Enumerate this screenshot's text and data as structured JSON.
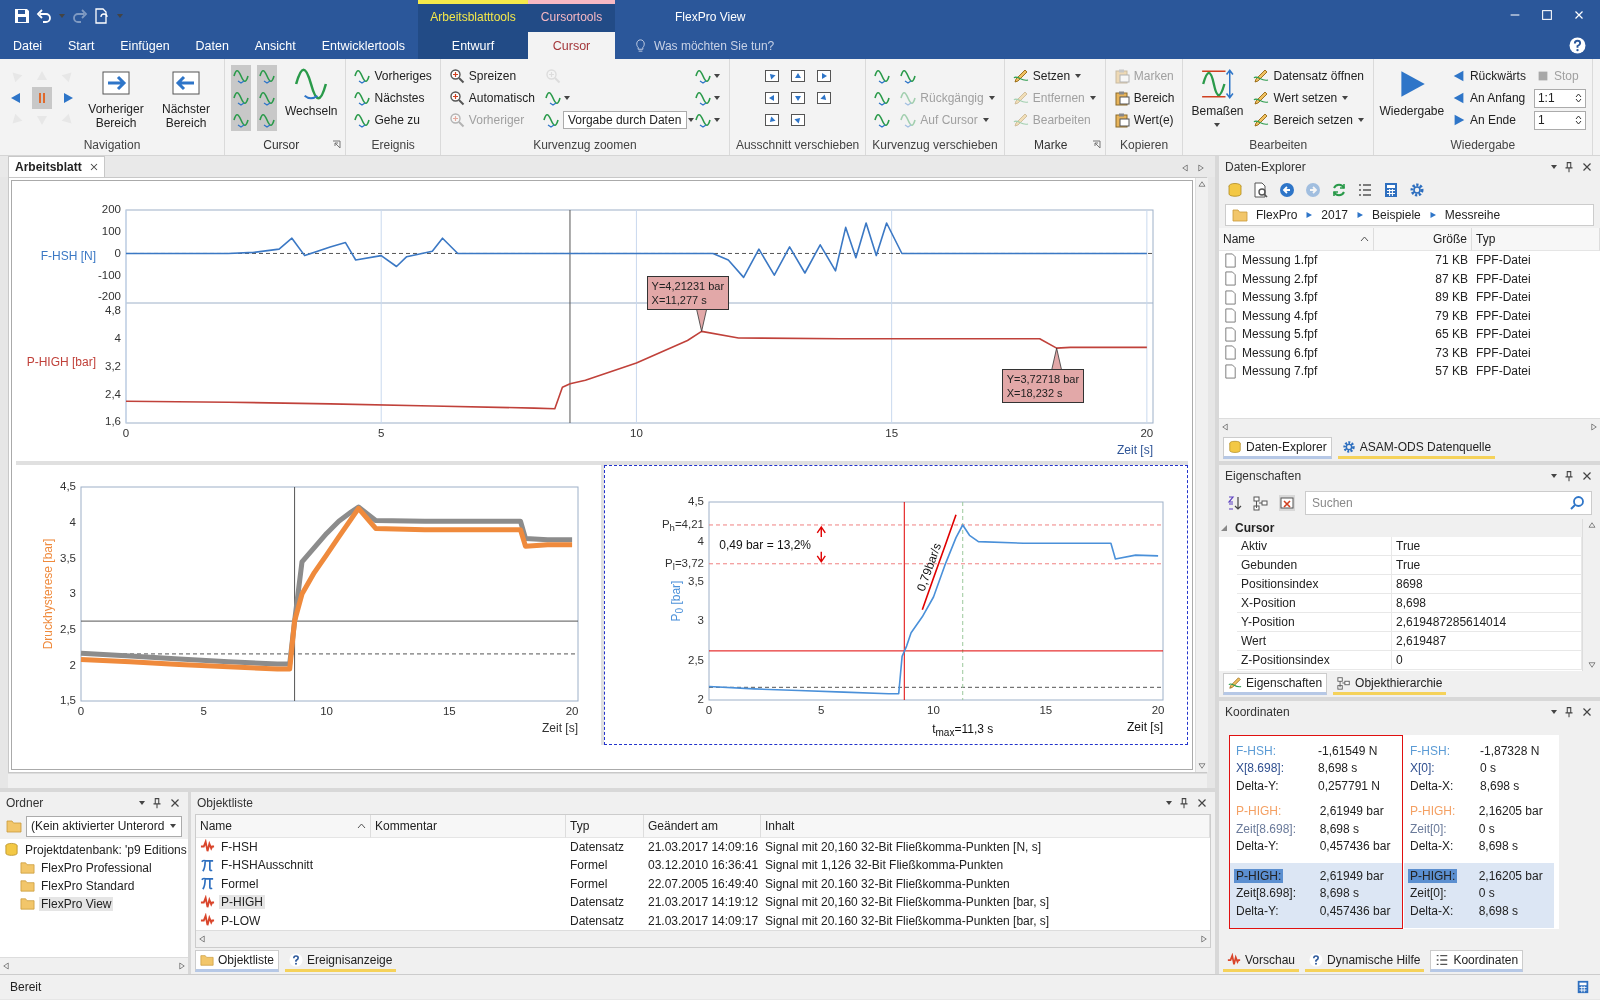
{
  "title_bar": {
    "title": "FlexPro View",
    "context_tabs": [
      {
        "label": "Arbeitsblatttools",
        "color": "#f5e94a"
      },
      {
        "label": "Cursortools",
        "color": "#f7b9c4"
      }
    ]
  },
  "tabs": [
    {
      "label": "Datei",
      "selected": false,
      "contextual": false
    },
    {
      "label": "Start",
      "selected": false,
      "contextual": false
    },
    {
      "label": "Einfügen",
      "selected": false,
      "contextual": false
    },
    {
      "label": "Daten",
      "selected": false,
      "contextual": false
    },
    {
      "label": "Ansicht",
      "selected": false,
      "contextual": false
    },
    {
      "label": "Entwicklertools",
      "selected": false,
      "contextual": false
    },
    {
      "label": "Entwurf",
      "selected": false,
      "contextual": true
    },
    {
      "label": "Cursor",
      "selected": true,
      "contextual": true
    }
  ],
  "search": {
    "placeholder": "Was möchten Sie tun?"
  },
  "ribbon": [
    {
      "label": "Navigation",
      "launcher": false,
      "items": [
        {
          "kind": "icon",
          "disabled": true,
          "menu": false
        },
        {
          "kind": "icon",
          "disabled": false,
          "menu": false
        },
        {
          "kind": "icon",
          "disabled": true,
          "menu": false
        },
        {
          "kind": "icon",
          "disabled": true,
          "menu": false
        },
        {
          "kind": "icon",
          "disabled": false,
          "menu": false
        },
        {
          "kind": "icon",
          "disabled": true,
          "menu": false
        },
        {
          "kind": "icon",
          "disabled": true,
          "menu": false
        },
        {
          "kind": "icon",
          "disabled": false,
          "menu": false
        },
        {
          "kind": "icon",
          "disabled": true,
          "menu": false
        },
        {
          "kind": "large",
          "label": "Vorheriger Bereich",
          "disabled": false,
          "menu": false
        },
        {
          "kind": "large",
          "label": "Nächster Bereich",
          "disabled": false,
          "menu": false
        }
      ]
    },
    {
      "label": "Cursor",
      "launcher": true,
      "items": [
        {
          "kind": "icon",
          "disabled": false,
          "menu": false
        },
        {
          "kind": "icon",
          "disabled": false,
          "menu": false
        },
        {
          "kind": "icon",
          "disabled": false,
          "menu": false
        },
        {
          "kind": "icon",
          "disabled": false,
          "menu": false
        },
        {
          "kind": "icon",
          "disabled": false,
          "menu": false
        },
        {
          "kind": "icon",
          "disabled": false,
          "menu": false
        },
        {
          "kind": "large",
          "label": "Wechseln",
          "disabled": false,
          "menu": false
        }
      ]
    },
    {
      "label": "Ereignis",
      "launcher": false,
      "items": [
        {
          "kind": "small",
          "label": "Vorheriges",
          "disabled": false,
          "menu": false
        },
        {
          "kind": "small",
          "label": "Nächstes",
          "disabled": false,
          "menu": false
        },
        {
          "kind": "small",
          "label": "Gehe zu",
          "disabled": false,
          "menu": false
        }
      ]
    },
    {
      "label": "Kurvenzug zoomen",
      "launcher": false,
      "items": [
        {
          "kind": "small",
          "label": "Spreizen",
          "disabled": false,
          "menu": false
        },
        {
          "kind": "small",
          "label": "Automatisch",
          "disabled": false,
          "menu": false
        },
        {
          "kind": "small",
          "label": "Vorheriger",
          "disabled": true,
          "menu": false
        },
        {
          "kind": "icon",
          "disabled": true,
          "menu": false
        },
        {
          "kind": "icon",
          "disabled": false,
          "menu": true
        },
        {
          "kind": "select",
          "value": "Vorgabe durch Daten",
          "disabled": false,
          "menu": true
        },
        {
          "kind": "icon",
          "disabled": false,
          "menu": true
        },
        {
          "kind": "icon",
          "disabled": false,
          "menu": true
        },
        {
          "kind": "icon",
          "disabled": false,
          "menu": true
        }
      ]
    },
    {
      "label": "Ausschnitt verschieben",
      "launcher": false,
      "items": [
        {
          "kind": "icon",
          "disabled": false,
          "menu": false
        },
        {
          "kind": "icon",
          "disabled": false,
          "menu": false
        },
        {
          "kind": "icon",
          "disabled": false,
          "menu": false
        },
        {
          "kind": "icon",
          "disabled": false,
          "menu": false
        },
        {
          "kind": "icon",
          "disabled": false,
          "menu": false
        },
        {
          "kind": "icon",
          "disabled": false,
          "menu": false
        },
        {
          "kind": "icon",
          "disabled": false,
          "menu": false
        },
        {
          "kind": "icon",
          "disabled": false,
          "menu": false
        }
      ]
    },
    {
      "label": "Kurvenzug verschieben",
      "launcher": false,
      "items": [
        {
          "kind": "icon",
          "disabled": false,
          "menu": false
        },
        {
          "kind": "icon",
          "disabled": false,
          "menu": false
        },
        {
          "kind": "icon",
          "disabled": false,
          "menu": false
        },
        {
          "kind": "icon",
          "disabled": false,
          "menu": false
        },
        {
          "kind": "small",
          "label": "Rückgängig",
          "disabled": true,
          "menu": true
        },
        {
          "kind": "small",
          "label": "Auf Cursor",
          "disabled": true,
          "menu": true
        }
      ]
    },
    {
      "label": "Marke",
      "launcher": true,
      "items": [
        {
          "kind": "small",
          "label": "Setzen",
          "disabled": false,
          "menu": true
        },
        {
          "kind": "small",
          "label": "Entfernen",
          "disabled": true,
          "menu": true
        },
        {
          "kind": "small",
          "label": "Bearbeiten",
          "disabled": true,
          "menu": false
        }
      ]
    },
    {
      "label": "Kopieren",
      "launcher": false,
      "items": [
        {
          "kind": "small",
          "label": "Marken",
          "disabled": true,
          "menu": false
        },
        {
          "kind": "small",
          "label": "Bereich",
          "disabled": false,
          "menu": false
        },
        {
          "kind": "small",
          "label": "Wert(e)",
          "disabled": false,
          "menu": false
        }
      ]
    },
    {
      "label": "Bearbeiten",
      "launcher": false,
      "items": [
        {
          "kind": "large",
          "label": "Bemaßen",
          "disabled": false,
          "menu": true
        },
        {
          "kind": "small",
          "label": "Datensatz öffnen",
          "disabled": false,
          "menu": false
        },
        {
          "kind": "small",
          "label": "Wert setzen",
          "disabled": false,
          "menu": true
        },
        {
          "kind": "small",
          "label": "Bereich setzen",
          "disabled": false,
          "menu": true
        }
      ]
    },
    {
      "label": "Wiedergabe",
      "launcher": false,
      "items": [
        {
          "kind": "large",
          "label": "Wiedergabe",
          "disabled": false,
          "menu": false
        },
        {
          "kind": "small",
          "label": "Rückwärts",
          "disabled": false,
          "menu": false
        },
        {
          "kind": "small",
          "label": "An Anfang",
          "disabled": false,
          "menu": false
        },
        {
          "kind": "small",
          "label": "An Ende",
          "disabled": false,
          "menu": false
        },
        {
          "kind": "small",
          "label": "Stop",
          "disabled": true,
          "menu": false
        },
        {
          "kind": "spin",
          "value": "1:1",
          "disabled": false,
          "menu": false
        },
        {
          "kind": "spin",
          "value": "1",
          "disabled": false,
          "menu": false
        }
      ]
    }
  ],
  "document_tab": {
    "label": "Arbeitsblatt",
    "selected": true
  },
  "worksheet": {
    "charts": [
      {
        "chart_data": {
          "type": "line",
          "grid": true,
          "ylabel": "F-HSH [N]",
          "xlim": [
            0,
            20.12
          ],
          "ylim": [
            -228,
            200
          ],
          "yticks": [
            -200,
            -100,
            0,
            100,
            200
          ],
          "x": [
            0,
            0.5,
            1,
            1.5,
            2,
            2.5,
            3,
            3.25,
            3.5,
            4,
            4.3,
            4.5,
            5,
            5.3,
            5.5,
            6,
            6.2,
            6.5,
            7,
            8,
            9,
            10,
            11,
            11.5,
            11.8,
            12.1,
            12.4,
            12.7,
            13,
            13.3,
            13.6,
            13.9,
            14.1,
            14.3,
            14.5,
            14.7,
            14.9,
            15.2,
            15.5,
            16,
            17,
            18,
            19,
            20
          ],
          "series": [
            {
              "color": "#3b78c4",
              "values": [
                0,
                0,
                0,
                0,
                0,
                5,
                20,
                70,
                -10,
                30,
                50,
                -30,
                -10,
                -60,
                -15,
                10,
                70,
                0,
                0,
                0,
                0,
                0,
                0,
                0,
                -30,
                -110,
                20,
                -100,
                30,
                -90,
                40,
                -80,
                120,
                -20,
                140,
                -10,
                140,
                0,
                0,
                0,
                0,
                0,
                0,
                0
              ]
            }
          ],
          "ref_lines": [
            {
              "axis": "x",
              "value": 8.698,
              "color": "#555555"
            },
            {
              "axis": "y",
              "value": 0,
              "color": "#555555"
            }
          ]
        }
      },
      {
        "chart_data": {
          "type": "line",
          "grid": true,
          "ylabel": "P-HIGH [bar]",
          "xlabel": "Zeit [s]",
          "xlim": [
            0,
            20.12
          ],
          "ylim": [
            1.57,
            5.03
          ],
          "xticks": [
            0,
            5,
            10,
            15,
            20
          ],
          "yticks": [
            {
              "value": 1.6,
              "label": "1,6"
            },
            {
              "value": 2.4,
              "label": "2,4"
            },
            {
              "value": 3.2,
              "label": "3,2"
            },
            {
              "value": 4,
              "label": "4"
            },
            {
              "value": 4.8,
              "label": "4,8"
            }
          ],
          "x": [
            0,
            2,
            4,
            6,
            8,
            8.4,
            8.55,
            8.7,
            9,
            10,
            11,
            11.277,
            12,
            14,
            16,
            17.9,
            18.232,
            18.5,
            20
          ],
          "series": [
            {
              "color": "#c0413a",
              "values": [
                2.2,
                2.17,
                2.12,
                2.06,
                2.0,
                1.98,
                2.6,
                2.7,
                2.8,
                3.3,
                3.95,
                4.21,
                4.02,
                4.0,
                4.0,
                4.0,
                3.73,
                3.75,
                3.75
              ]
            }
          ],
          "ref_lines": [
            {
              "axis": "x",
              "value": 8.698,
              "color": "#555555"
            }
          ],
          "annotations": [
            {
              "x": 11.277,
              "y": 4.21231,
              "text": "Y=4,21231 bar\nX=11,277 s"
            },
            {
              "x": 18.232,
              "y": 3.72718,
              "text": "Y=3,72718 bar\nX=18,232 s"
            }
          ]
        }
      },
      {
        "chart_data": {
          "type": "line",
          "ylabel": "Druckhysterese [bar]",
          "xlabel": "Zeit [s]",
          "xlim": [
            0,
            20.24
          ],
          "ylim": [
            1.5,
            4.5
          ],
          "xticks": [
            0,
            5,
            10,
            15,
            20
          ],
          "yticks": [
            {
              "value": 1.5,
              "label": "1,5"
            },
            {
              "value": 2,
              "label": "2"
            },
            {
              "value": 2.5,
              "label": "2,5"
            },
            {
              "value": 3,
              "label": "3"
            },
            {
              "value": 3.5,
              "label": "3,5"
            },
            {
              "value": 4,
              "label": "4"
            },
            {
              "value": 4.5,
              "label": "4,5"
            }
          ],
          "x": [
            0,
            2,
            4,
            6,
            8,
            8.5,
            8.7,
            9,
            9.5,
            10,
            10.5,
            11,
            11.3,
            12,
            14,
            16,
            17.9,
            18.1,
            19,
            20
          ],
          "series": [
            {
              "color": "#8c8c8c",
              "values": [
                2.17,
                2.13,
                2.09,
                2.05,
                2.02,
                2.02,
                2.62,
                3.45,
                3.65,
                3.85,
                4.02,
                4.15,
                4.22,
                4.03,
                4.02,
                4.02,
                4.02,
                3.78,
                3.76,
                3.76
              ]
            },
            {
              "color": "#ef8a3c",
              "values": [
                2.08,
                2.05,
                2.01,
                1.98,
                1.95,
                1.95,
                2.62,
                3.0,
                3.3,
                3.55,
                3.8,
                4.05,
                4.2,
                3.92,
                3.9,
                3.9,
                3.9,
                3.67,
                3.69,
                3.69
              ]
            }
          ],
          "ref_lines": [
            {
              "axis": "x",
              "value": 8.698,
              "color": "#555555"
            },
            {
              "axis": "y",
              "value": 2.62,
              "color": "#555555"
            },
            {
              "axis": "y",
              "value": 2.16,
              "color": "#555555"
            }
          ]
        }
      },
      {
        "chart_data": {
          "type": "line",
          "ylabel": "P$_{0}$ [bar]",
          "xlabel": "Zeit [s]",
          "xlim": [
            0,
            20.22
          ],
          "ylim": [
            2,
            4.5
          ],
          "xticks": [
            0,
            5,
            10,
            15,
            20
          ],
          "yticks": [
            {
              "value": 2,
              "label": "2"
            },
            {
              "value": 2.5,
              "label": "2,5"
            },
            {
              "value": 3,
              "label": "3"
            },
            {
              "value": 3.5,
              "label": "3,5"
            },
            {
              "value": 4,
              "label": "4"
            },
            {
              "value": 4.5,
              "label": "4,5"
            },
            {
              "value": 4.21,
              "label": "P$_{h}$=4,21"
            },
            {
              "value": 3.72,
              "label": "P$_{l}$=3,72"
            }
          ],
          "x": [
            0,
            2,
            4,
            6,
            8,
            8.45,
            8.6,
            8.8,
            9,
            9.5,
            10,
            10.5,
            11,
            11.3,
            11.6,
            12,
            14,
            16,
            17.9,
            18.1,
            19,
            20
          ],
          "series": [
            {
              "color": "#4a90d9",
              "values": [
                2.17,
                2.14,
                2.12,
                2.1,
                2.08,
                2.08,
                2.55,
                2.68,
                2.85,
                3.05,
                3.3,
                3.7,
                4.05,
                4.21,
                4.08,
                4.0,
                3.98,
                3.98,
                3.98,
                3.78,
                3.83,
                3.82
              ]
            },
            {
              "color": "#e00000",
              "values": [
                null,
                null,
                null,
                null,
                null,
                null,
                null,
                null,
                null,
                3.14,
                3.54,
                3.94,
                4.34,
                null,
                null,
                null,
                null,
                null,
                null,
                null,
                null,
                null
              ]
            }
          ],
          "ref_lines": [
            {
              "axis": "y",
              "value": 4.21,
              "color": "#f08080"
            },
            {
              "axis": "y",
              "value": 3.72,
              "color": "#f08080"
            },
            {
              "axis": "y",
              "value": 2.16,
              "color": "#555555"
            },
            {
              "axis": "x",
              "value": 11.3,
              "color": "#9cc89c"
            },
            {
              "axis": "x",
              "value": 8.698,
              "color": "#e00000"
            },
            {
              "axis": "y",
              "value": 2.62,
              "color": "#e00000"
            }
          ],
          "annotations": [
            "0,49 bar = 13,2%",
            "0,79bar/s",
            "t$_{max}$=11,3 s"
          ]
        }
      }
    ]
  },
  "data_explorer": {
    "title": "Daten-Explorer",
    "path": [
      "FlexPro",
      "2017",
      "Beispiele",
      "Messreihe"
    ],
    "columns": [
      {
        "label": "Name",
        "sorted": true
      },
      {
        "label": "Größe",
        "sorted": false
      },
      {
        "label": "Typ",
        "sorted": false
      }
    ],
    "rows": [
      {
        "name": "Messung 1.fpf",
        "size": "71 KB",
        "type": "FPF-Datei"
      },
      {
        "name": "Messung 2.fpf",
        "size": "87 KB",
        "type": "FPF-Datei"
      },
      {
        "name": "Messung 3.fpf",
        "size": "89 KB",
        "type": "FPF-Datei"
      },
      {
        "name": "Messung 4.fpf",
        "size": "79 KB",
        "type": "FPF-Datei"
      },
      {
        "name": "Messung 5.fpf",
        "size": "65 KB",
        "type": "FPF-Datei"
      },
      {
        "name": "Messung 6.fpf",
        "size": "73 KB",
        "type": "FPF-Datei"
      },
      {
        "name": "Messung 7.fpf",
        "size": "57 KB",
        "type": "FPF-Datei"
      }
    ],
    "tabs": [
      {
        "label": "Daten-Explorer",
        "selected": true
      },
      {
        "label": "ASAM-ODS Datenquelle",
        "selected": false
      }
    ]
  },
  "properties": {
    "title": "Eigenschaften",
    "search": {
      "placeholder": "Suchen"
    },
    "category": {
      "label": "Cursor",
      "expanded": true
    },
    "rows": [
      {
        "name": "Aktiv",
        "value": "True"
      },
      {
        "name": "Gebunden",
        "value": "True"
      },
      {
        "name": "Positionsindex",
        "value": "8698"
      },
      {
        "name": "X-Position",
        "value": "8,698"
      },
      {
        "name": "Y-Position",
        "value": "2,619487285614014"
      },
      {
        "name": "Wert",
        "value": "2,619487"
      },
      {
        "name": "Z-Positionsindex",
        "value": "0"
      }
    ],
    "tabs": [
      {
        "label": "Eigenschaften",
        "selected": true
      },
      {
        "label": "Objekthierarchie",
        "selected": false
      }
    ]
  },
  "coordinates": {
    "title": "Koordinaten",
    "columns": [
      {
        "selected": true,
        "groups": [
          {
            "highlighted": false,
            "rows": [
              {
                "label": "F-HSH:",
                "value": "-1,61549 N",
                "color": "#5b9bd5",
                "selected": false
              },
              {
                "label": "X[8.698]:",
                "value": "8,698 s",
                "color": "#2f4f8f",
                "selected": false
              },
              {
                "label": "Delta-Y:",
                "value": "0,257791 N",
                "color": "#222222",
                "selected": false
              }
            ]
          },
          {
            "highlighted": false,
            "rows": [
              {
                "label": "P-HIGH:",
                "value": "2,61949 bar",
                "color": "#f4a063",
                "selected": false
              },
              {
                "label": "Zeit[8.698]:",
                "value": "8,698 s",
                "color": "#6a7a9a",
                "selected": false
              },
              {
                "label": "Delta-Y:",
                "value": "0,457436 bar",
                "color": "#222222",
                "selected": false
              }
            ]
          },
          {
            "highlighted": true,
            "rows": [
              {
                "label": "P-HIGH:",
                "value": "2,61949 bar",
                "selected": true
              },
              {
                "label": "Zeit[8.698]:",
                "value": "8,698 s",
                "color": "#222222",
                "selected": false
              },
              {
                "label": "Delta-Y:",
                "value": "0,457436 bar",
                "color": "#222222",
                "selected": false
              }
            ]
          }
        ]
      },
      {
        "selected": false,
        "groups": [
          {
            "highlighted": false,
            "rows": [
              {
                "label": "F-HSH:",
                "value": "-1,87328 N",
                "color": "#5b9bd5",
                "selected": false
              },
              {
                "label": "X[0]:",
                "value": "0 s",
                "color": "#2f4f8f",
                "selected": false
              },
              {
                "label": "Delta-X:",
                "value": "8,698 s",
                "color": "#222222",
                "selected": false
              }
            ]
          },
          {
            "highlighted": false,
            "rows": [
              {
                "label": "P-HIGH:",
                "value": "2,16205 bar",
                "color": "#f4a063",
                "selected": false
              },
              {
                "label": "Zeit[0]:",
                "value": "0 s",
                "color": "#6a7a9a",
                "selected": false
              },
              {
                "label": "Delta-X:",
                "value": "8,698 s",
                "color": "#222222",
                "selected": false
              }
            ]
          },
          {
            "highlighted": true,
            "rows": [
              {
                "label": "P-HIGH:",
                "value": "2,16205 bar",
                "selected": true
              },
              {
                "label": "Zeit[0]:",
                "value": "0 s",
                "color": "#222222",
                "selected": false
              },
              {
                "label": "Delta-X:",
                "value": "8,698 s",
                "color": "#222222",
                "selected": false
              }
            ]
          }
        ]
      }
    ],
    "tabs": [
      {
        "label": "Vorschau",
        "selected": false
      },
      {
        "label": "Dynamische Hilfe",
        "selected": false
      },
      {
        "label": "Koordinaten",
        "selected": true
      }
    ]
  },
  "folders": {
    "title": "Ordner",
    "dropdown": "(Kein aktivierter Unterord",
    "tree": [
      {
        "label": "Projektdatenbank: 'p9 Editions",
        "kind": "database",
        "selected": false,
        "children": [
          {
            "label": "FlexPro Professional",
            "kind": "folder",
            "selected": false
          },
          {
            "label": "FlexPro Standard",
            "kind": "folder",
            "selected": false
          },
          {
            "label": "FlexPro View",
            "kind": "folder",
            "selected": true
          }
        ]
      }
    ]
  },
  "object_list": {
    "title": "Objektliste",
    "columns": [
      {
        "label": "Name",
        "sorted": true
      },
      {
        "label": "Kommentar",
        "sorted": false
      },
      {
        "label": "Typ",
        "sorted": false
      },
      {
        "label": "Geändert am",
        "sorted": false
      },
      {
        "label": "Inhalt",
        "sorted": false
      }
    ],
    "rows": [
      {
        "kind": "dataset",
        "name": "F-HSH",
        "type": "Datensatz",
        "changed": "21.03.2017 14:09:16",
        "content": "Signal mit 20,160 32-Bit Fließkomma-Punkten [N, s]",
        "selected": false
      },
      {
        "kind": "formula",
        "name": "F-HSHAusschnitt",
        "type": "Formel",
        "changed": "03.12.2010 16:36:41",
        "content": "Signal mit 1,126 32-Bit Fließkomma-Punkten",
        "selected": false
      },
      {
        "kind": "formula",
        "name": "Formel",
        "type": "Formel",
        "changed": "22.07.2005 16:49:40",
        "content": "Signal mit 20.160 32-Bit Fließkomma-Punkten",
        "selected": false
      },
      {
        "kind": "dataset",
        "name": "P-HIGH",
        "type": "Datensatz",
        "changed": "21.03.2017 14:19:12",
        "content": "Signal mit 20,160 32-Bit Fließkomma-Punkten [bar, s]",
        "selected": true
      },
      {
        "kind": "dataset",
        "name": "P-LOW",
        "type": "Datensatz",
        "changed": "21.03.2017 14:09:17",
        "content": "Signal mit 20.160 32-Bit Fließkomma-Punkten [bar, s]",
        "selected": false
      }
    ],
    "tabs": [
      {
        "label": "Objektliste",
        "selected": true
      },
      {
        "label": "Ereignisanzeige",
        "selected": false
      }
    ]
  },
  "status_bar": {
    "text": "Bereit"
  }
}
